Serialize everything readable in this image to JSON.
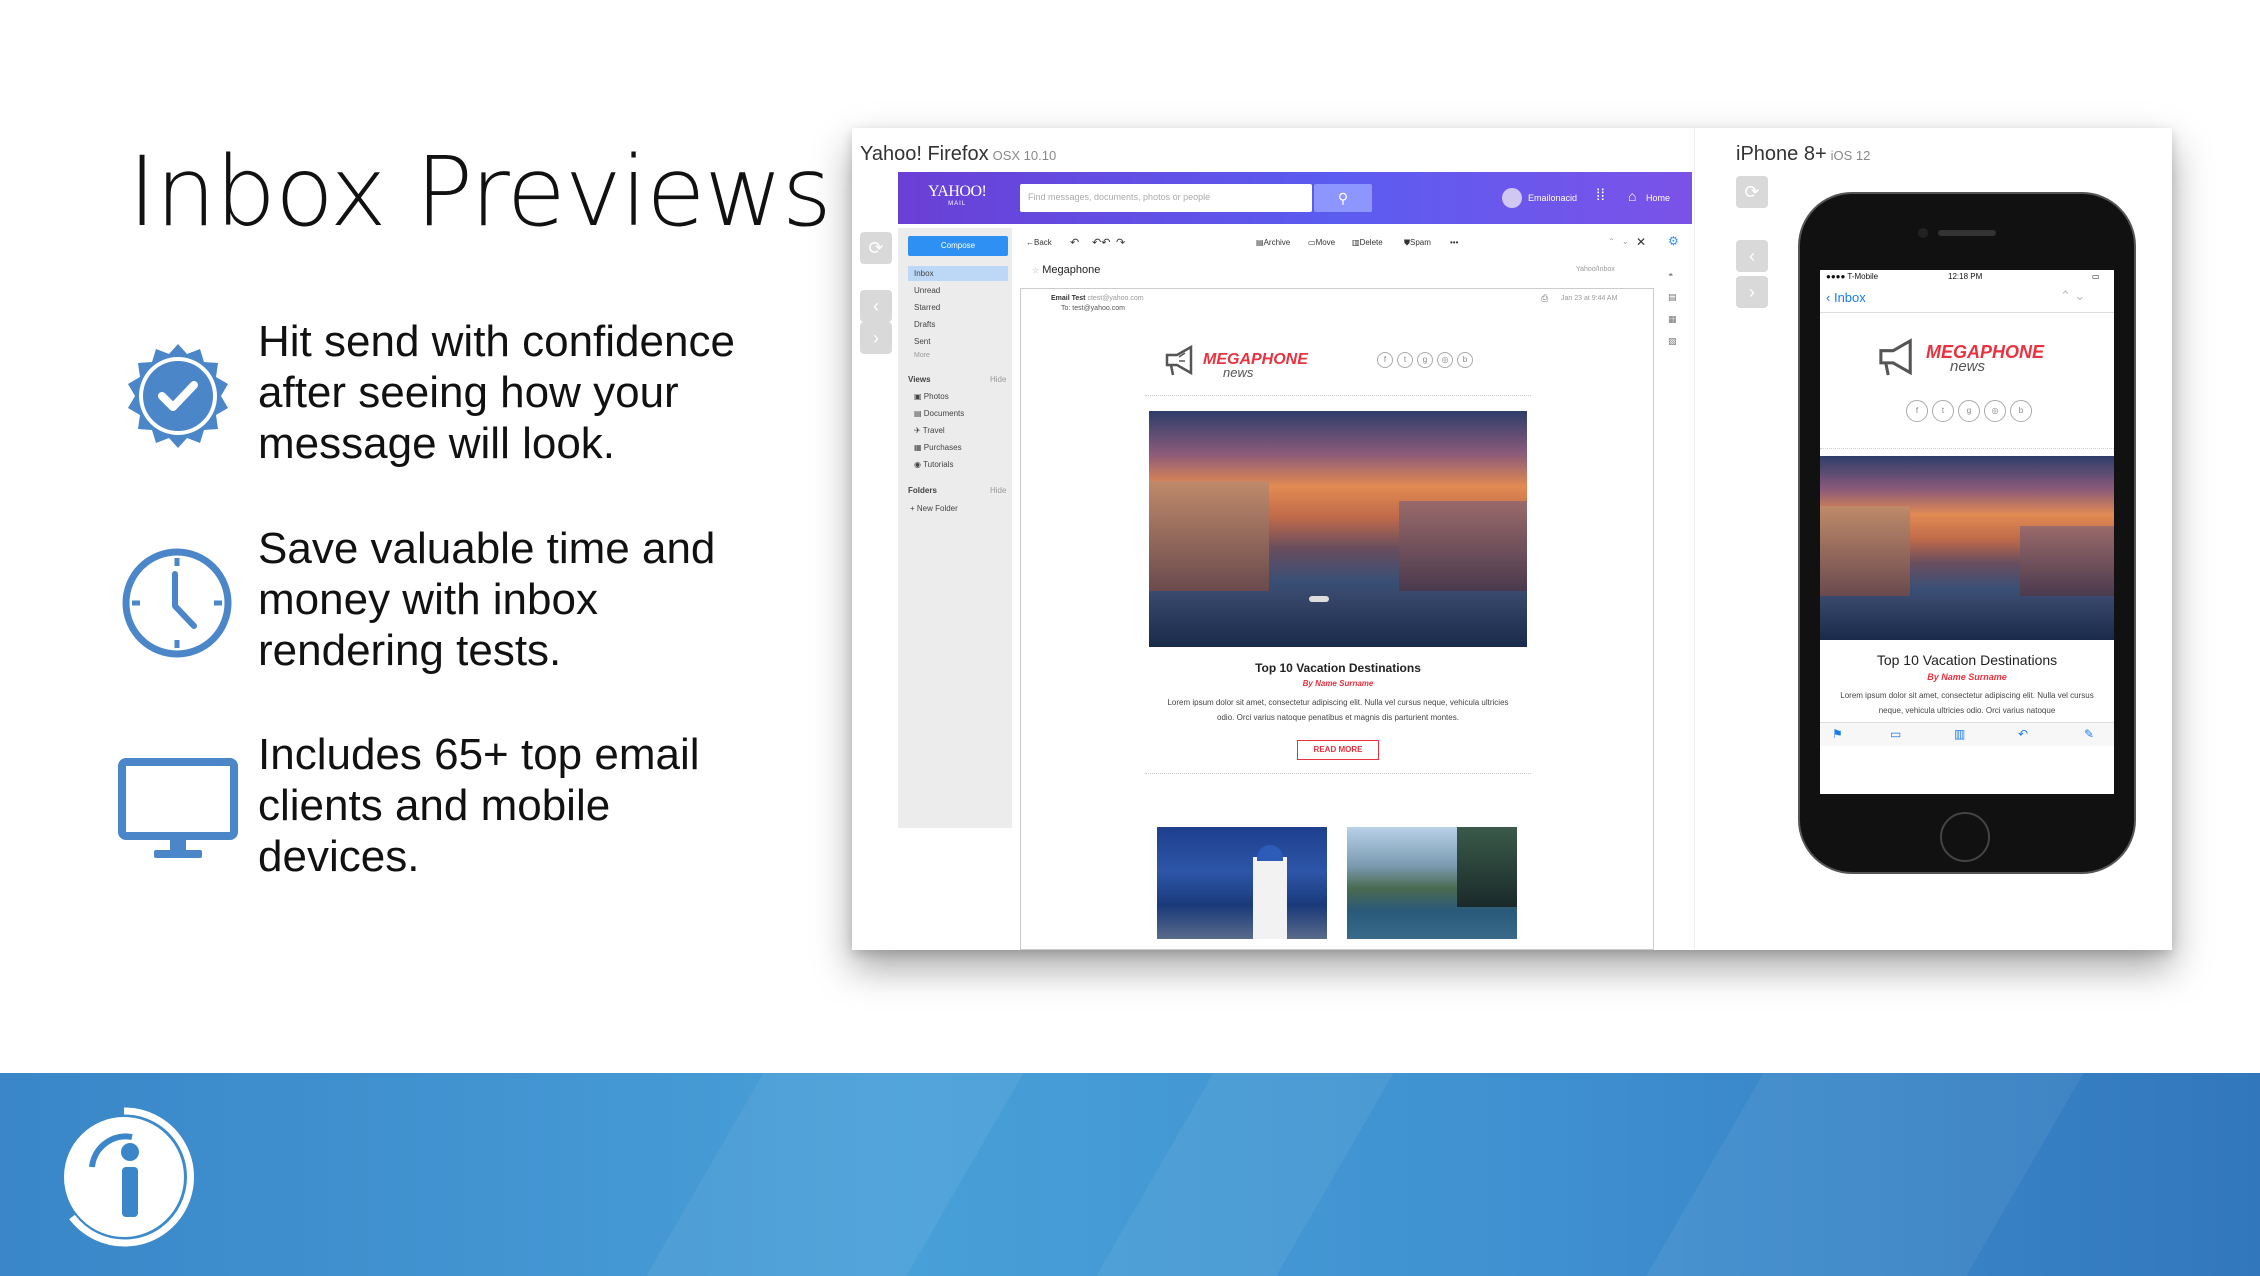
{
  "slide": {
    "title": "Inbox Previews",
    "features": [
      {
        "icon": "verified-badge-icon",
        "text": "Hit send with confidence after seeing how your message will look."
      },
      {
        "icon": "clock-icon",
        "text": "Save valuable time and money with inbox rendering tests."
      },
      {
        "icon": "monitor-icon",
        "text": "Includes 65+ top email clients and mobile devices."
      }
    ],
    "accent_color": "#4a86c8",
    "footer_color": "#3a86c8"
  },
  "screenshot": {
    "desktop_client": {
      "name": "Yahoo! Firefox",
      "version": "OSX 10.10"
    },
    "mobile_client": {
      "name": "iPhone 8+",
      "version": "iOS 12"
    },
    "yahoo": {
      "logo": "YAHOO!",
      "logo_sub": "MAIL",
      "search_placeholder": "Find messages, documents, photos or people",
      "account_name": "Emailonacid",
      "home_label": "Home",
      "compose_label": "Compose",
      "folders": [
        "Inbox",
        "Unread",
        "Starred",
        "Drafts",
        "Sent",
        "More"
      ],
      "views_label": "Views",
      "views_hide": "Hide",
      "views": [
        "Photos",
        "Documents",
        "Travel",
        "Purchases",
        "Tutorials"
      ],
      "folders_label": "Folders",
      "folders_hide": "Hide",
      "new_folder": "+ New Folder",
      "toolbar": {
        "back": "Back",
        "archive": "Archive",
        "move": "Move",
        "delete": "Delete",
        "spam": "Spam",
        "more": "•••"
      },
      "subject": "Megaphone",
      "folder_path": "Yahoo/Inbox",
      "from_name": "Email Test",
      "from_addr": "ctest@yahoo.com",
      "to_line": "To: test@yahoo.com",
      "date": "Jan 23 at 9:44 AM"
    },
    "email": {
      "brand": "MEGAPHONE",
      "brand_sub": "news",
      "headline": "Top 10 Vacation Destinations",
      "byline": "By Name Surname",
      "body": "Lorem ipsum dolor sit amet, consectetur adipiscing elit. Nulla vel cursus neque, vehicula ultricies odio. Orci varius natoque penatibus et magnis dis parturient montes.",
      "mobile_body": "Lorem ipsum dolor sit amet, consectetur adipiscing elit. Nulla vel cursus neque, vehicula ultricies odio. Orci varius natoque",
      "cta": "READ MORE"
    },
    "iphone": {
      "carrier": "T-Mobile",
      "time": "12:18 PM",
      "back_label": "Inbox"
    }
  }
}
